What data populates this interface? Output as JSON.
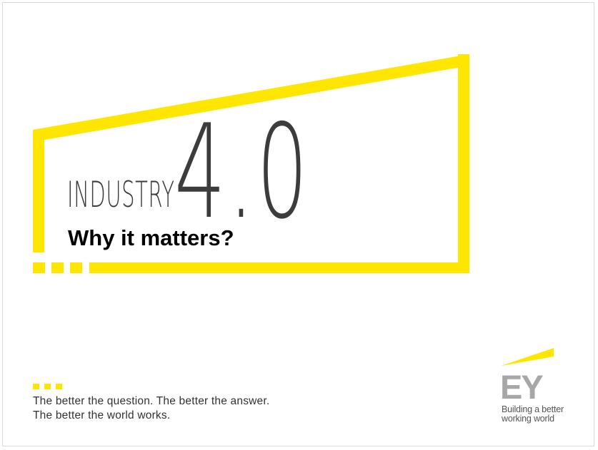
{
  "slide": {
    "title_word": "INDUSTRY",
    "title_number": "4.0",
    "subtitle": "Why it matters?"
  },
  "footer": {
    "tagline_line1": "The better the question. The better the answer.",
    "tagline_line2": "The better the world works."
  },
  "logo": {
    "mark": "EY",
    "tagline_line1": "Building a better",
    "tagline_line2": "working world"
  },
  "colors": {
    "accent_yellow": "#ffe600",
    "text_dark": "#3c3c3c",
    "logo_grey": "#a7a7a7"
  }
}
